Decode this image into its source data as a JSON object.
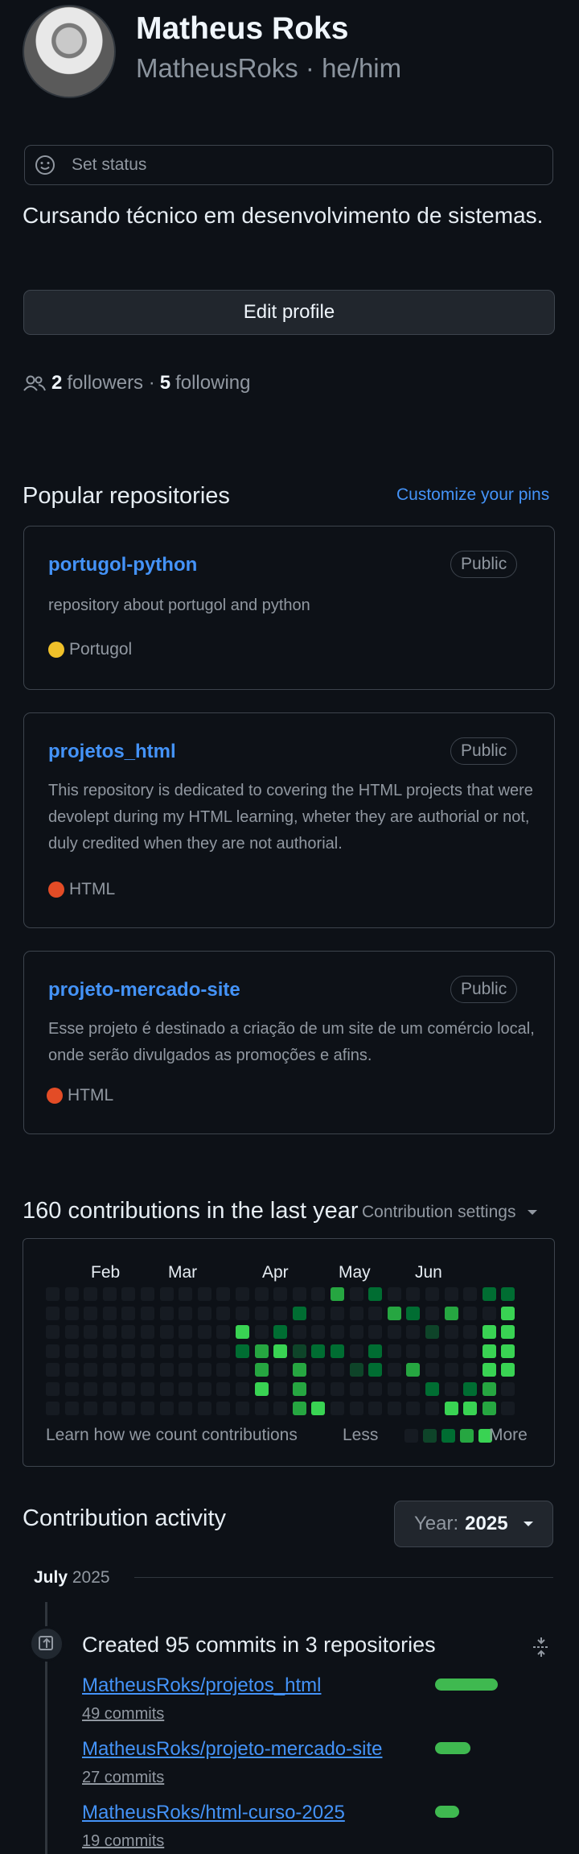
{
  "profile": {
    "name": "Matheus Roks",
    "login_pronouns": "MatheusRoks · he/him",
    "status_label": "Set status",
    "bio": "Cursando técnico em desenvolvimento de sistemas.",
    "edit_label": "Edit profile",
    "followers_count": "2",
    "followers_label": "followers ·",
    "following_count": "5",
    "following_label": "following"
  },
  "popular": {
    "title": "Popular repositories",
    "customize_label": "Customize your pins",
    "repos": [
      {
        "name": "portugol-python",
        "visibility": "Public",
        "description": "repository about portugol and python",
        "language": "Portugol",
        "lang_color": "#f0c12a"
      },
      {
        "name": "projetos_html",
        "visibility": "Public",
        "description": "This repository is dedicated to covering the HTML projects that were devolept during my HTML learning, wheter they are authorial or not, duly credited when they are not authorial.",
        "language": "HTML",
        "lang_color": "#e34c26"
      },
      {
        "name": "projeto-mercado-site",
        "visibility": "Public",
        "description": "Esse projeto é destinado a criação de um site de um comércio local, onde serão divulgados as promoções e afins.",
        "language": "HTML",
        "lang_color": "#e34c26"
      }
    ]
  },
  "contributions": {
    "title": "160 contributions in the last year",
    "settings_label": "Contribution settings",
    "months": [
      "Feb",
      "Mar",
      "Apr",
      "May",
      "Jun"
    ],
    "learn_label": "Learn how we count contributions",
    "less_label": "Less",
    "more_label": "More",
    "colors": {
      "empty": "#161b22",
      "l1": "#0e4429",
      "l2": "#006d32",
      "l3": "#26a641",
      "l4": "#39d353"
    }
  },
  "activity": {
    "title": "Contribution activity",
    "year_prefix": "Year:",
    "year_value": "2025",
    "month_label": "July",
    "month_year": "2025",
    "summary": "Created 95 commits in 3 repositories",
    "items": [
      {
        "repo": "MatheusRoks/projetos_html",
        "commits": "49 commits",
        "share": 0.52
      },
      {
        "repo": "MatheusRoks/projeto-mercado-site",
        "commits": "27 commits",
        "share": 0.29
      },
      {
        "repo": "MatheusRoks/html-curso-2025",
        "commits": "19 commits",
        "share": 0.2
      }
    ]
  }
}
